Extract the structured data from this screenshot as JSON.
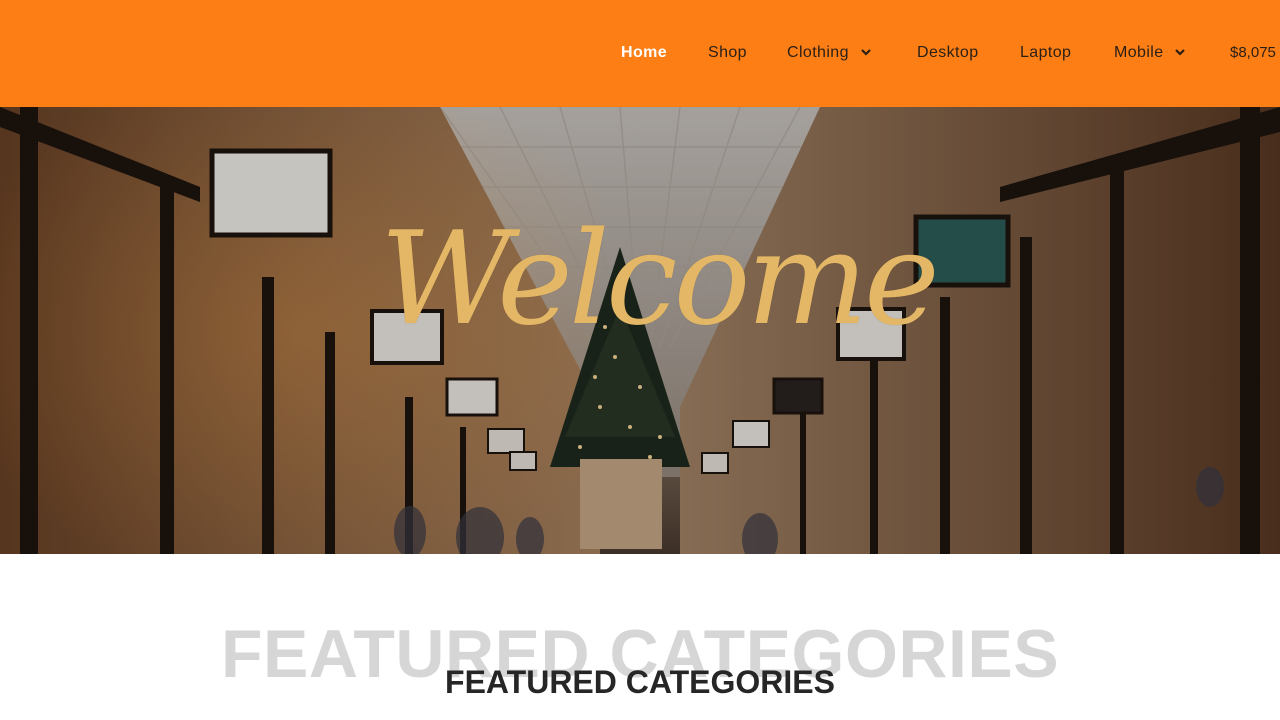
{
  "header": {
    "nav": [
      {
        "label": "Home",
        "active": true,
        "dropdown": false
      },
      {
        "label": "Shop",
        "active": false,
        "dropdown": false
      },
      {
        "label": "Clothing",
        "active": false,
        "dropdown": true
      },
      {
        "label": "Desktop",
        "active": false,
        "dropdown": false
      },
      {
        "label": "Laptop",
        "active": false,
        "dropdown": false
      },
      {
        "label": "Mobile",
        "active": false,
        "dropdown": true
      }
    ],
    "cart_total": "$8,075"
  },
  "hero": {
    "welcome_text": "Welcome"
  },
  "featured": {
    "background_text": "FEATURED CATEGORIES",
    "title": "FEATURED CATEGORIES"
  },
  "colors": {
    "header_bg": "#fd7e14",
    "nav_text": "#2a1f17",
    "nav_active": "#ffffff",
    "welcome": "#e3b766",
    "featured_bg_text": "#d6d6d6",
    "featured_title": "#262626"
  }
}
